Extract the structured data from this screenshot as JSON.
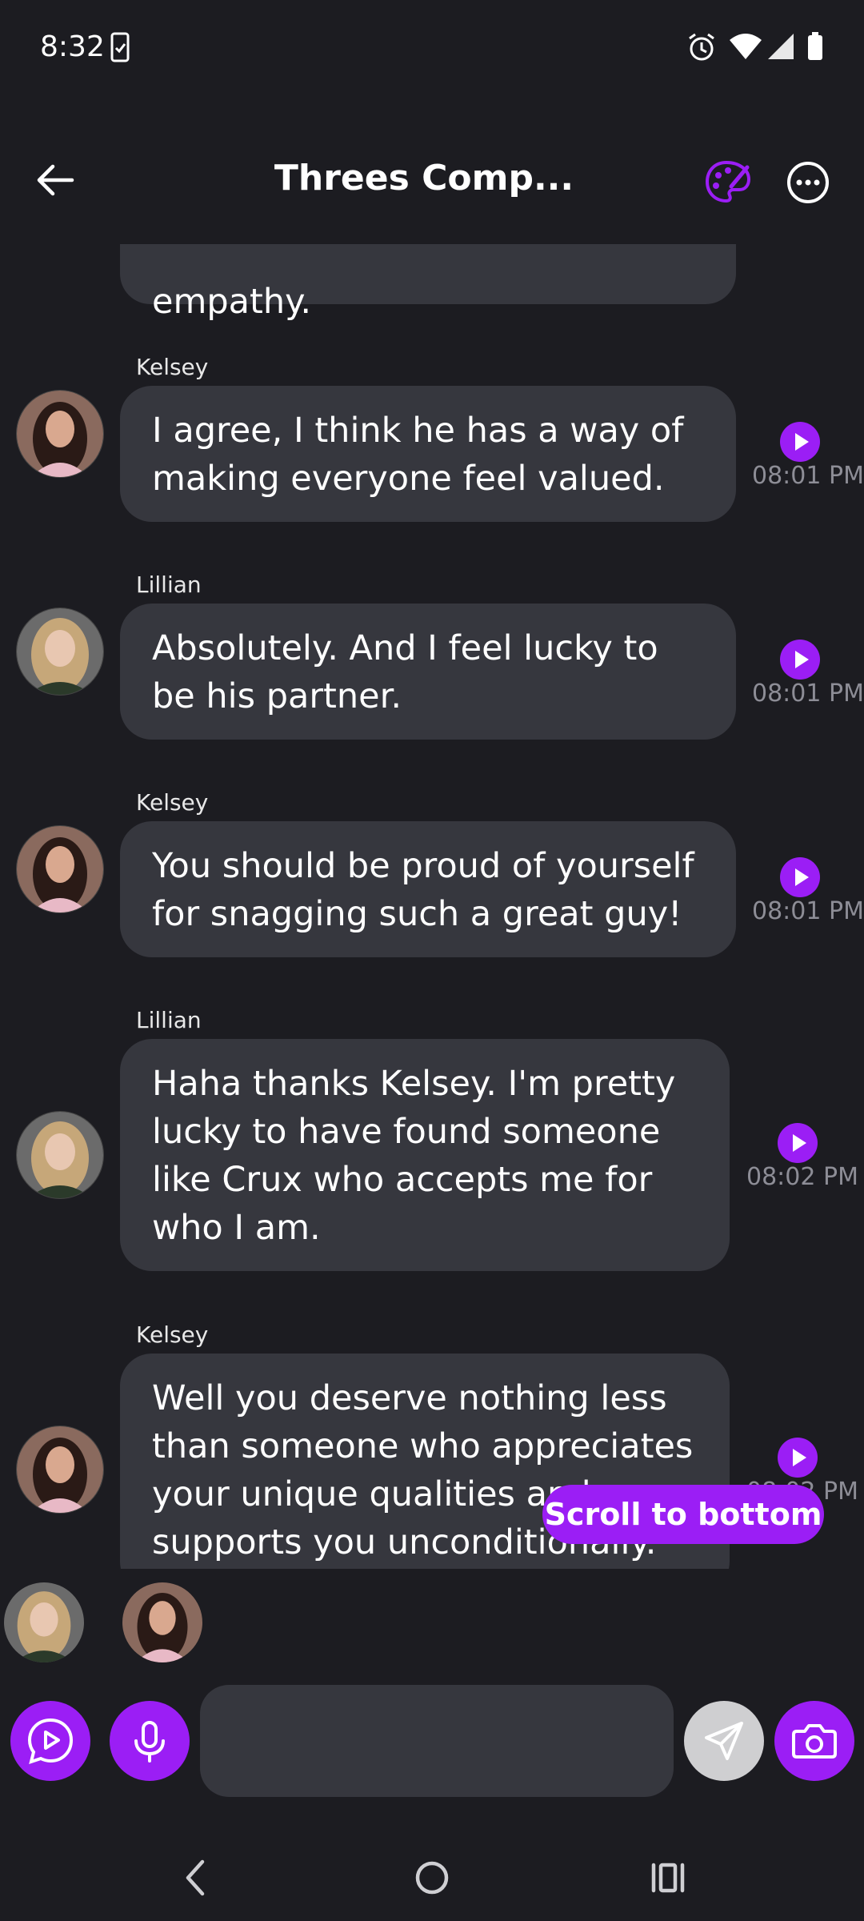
{
  "status_bar": {
    "time": "8:32"
  },
  "header": {
    "title": "Threes Comp..."
  },
  "top_message": {
    "text": "empathy."
  },
  "messages": [
    {
      "sender": "Kelsey",
      "text": "I agree, I think he has a way of making everyone feel valued.",
      "time": "08:01 PM"
    },
    {
      "sender": "Lillian",
      "text": "Absolutely. And I feel lucky to be his partner.",
      "time": "08:01 PM"
    },
    {
      "sender": "Kelsey",
      "text": "You should be proud of yourself for snagging such a great guy!",
      "time": "08:01 PM"
    },
    {
      "sender": "Lillian",
      "text": "Haha thanks Kelsey. I'm pretty lucky to have found someone like Crux who accepts me for who I am.",
      "time": "08:02 PM"
    },
    {
      "sender": "Kelsey",
      "text": "Well you deserve nothing less than someone who appreciates your unique qualities and supports you unconditionally.",
      "time": "08:02 PM"
    }
  ],
  "scroll_to_bottom": "Scroll to bottom",
  "composer": {
    "placeholder": ""
  },
  "icons": {
    "back": "arrow-left-icon",
    "palette": "palette-icon",
    "more": "more-horizontal-icon",
    "play": "play-icon",
    "video_chat": "play-message-icon",
    "mic": "microphone-icon",
    "send": "send-icon",
    "camera": "camera-icon"
  },
  "colors": {
    "accent": "#9b1ef5",
    "background": "#1c1c21",
    "bubble": "#36373e",
    "timestamp": "#8d8d96"
  }
}
